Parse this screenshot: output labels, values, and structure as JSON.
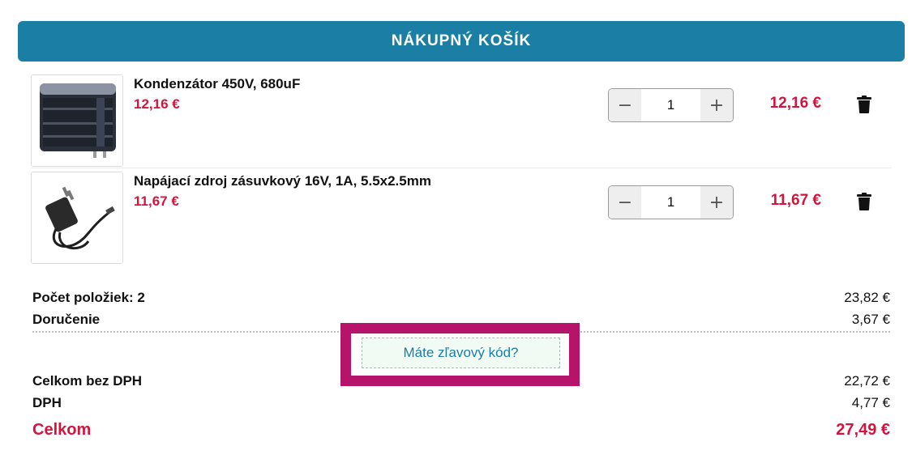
{
  "header": {
    "title": "NÁKUPNÝ KOŠÍK"
  },
  "items": [
    {
      "image": "capacitor-image",
      "name": "Kondenzátor 450V, 680uF",
      "unit_price": "12,16 €",
      "quantity": "1",
      "total": "12,16 €"
    },
    {
      "image": "power-adapter-image",
      "name": "Napájací zdroj zásuvkový 16V, 1A, 5.5x2.5mm",
      "unit_price": "11,67 €",
      "quantity": "1",
      "total": "11,67 €"
    }
  ],
  "stepper": {
    "minus": "−",
    "plus": "+"
  },
  "summary": {
    "count_label": "Počet položiek: 2",
    "count_value": "23,82 €",
    "delivery_label": "Doručenie",
    "delivery_value": "3,67 €",
    "coupon_label": "Máte zľavový kód?",
    "net_label": "Celkom bez DPH",
    "net_value": "22,72 €",
    "vat_label": "DPH",
    "vat_value": "4,77 €",
    "total_label": "Celkom",
    "total_value": "27,49 €"
  },
  "colors": {
    "header_bg": "#1a7ea5",
    "price_red": "#d4143c",
    "highlight_border": "#b5146a"
  },
  "icons": [
    "trash-icon",
    "minus-icon",
    "plus-icon"
  ]
}
